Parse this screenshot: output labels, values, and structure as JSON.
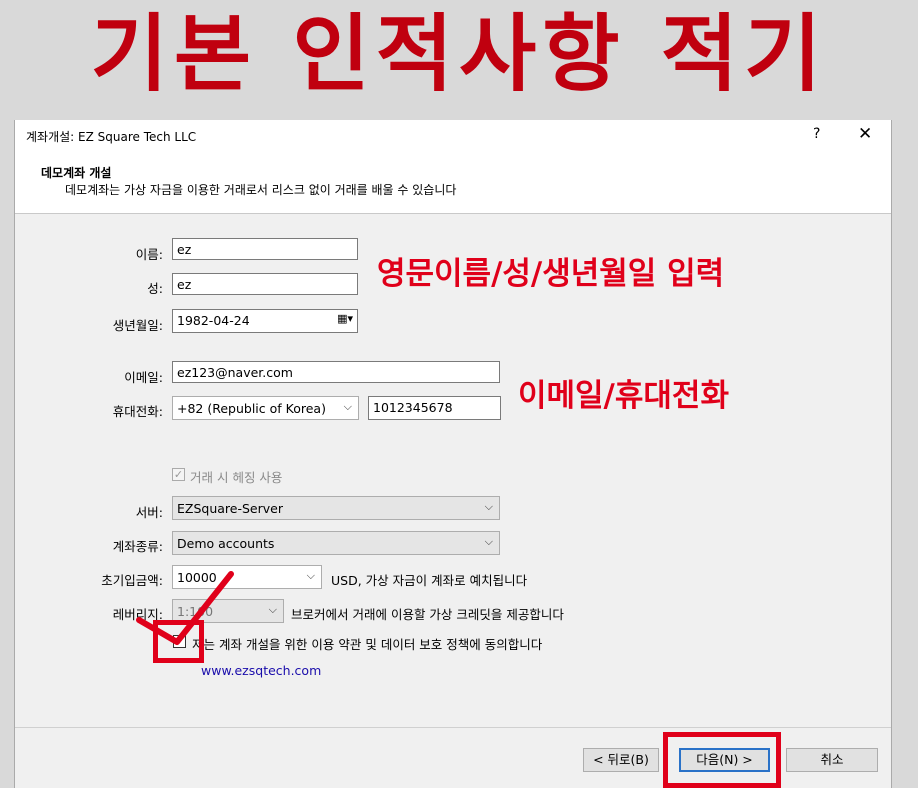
{
  "banner": {
    "title": "기본 인적사항 적기"
  },
  "window": {
    "title": "계좌개설: EZ Square Tech LLC",
    "help": "?",
    "close": "✕"
  },
  "header": {
    "heading": "데모계좌 개설",
    "description": "데모계좌는 가상 자금을 이용한 거래로서 리스크 없이 거래를 배울 수 있습니다"
  },
  "form": {
    "first_name": {
      "label": "이름:",
      "value": "ez"
    },
    "last_name": {
      "label": "성:",
      "value": "ez"
    },
    "birthdate": {
      "label": "생년월일:",
      "value": "1982-04-24"
    },
    "email": {
      "label": "이메일:",
      "value": "ez123@naver.com"
    },
    "phone": {
      "label": "휴대전화:",
      "country": "+82 (Republic of Korea)",
      "number": "1012345678"
    },
    "hedging": {
      "label": "거래 시 헤징 사용",
      "checked": true,
      "disabled": true
    },
    "server": {
      "label": "서버:",
      "value": "EZSquare-Server"
    },
    "account_type": {
      "label": "계좌종류:",
      "value": "Demo accounts"
    },
    "deposit": {
      "label": "초기입금액:",
      "value": "10000",
      "note": "USD, 가상 자금이 계좌로 예치됩니다"
    },
    "leverage": {
      "label": "레버리지:",
      "value": "1:100",
      "note": "브로커에서 거래에 이용할 가상 크레딧을 제공합니다"
    },
    "agreement": {
      "label": "저는 계좌 개설을 위한 이용 약관 및 데이터 보호 정책에 동의합니다",
      "checked": false
    },
    "link": "www.ezsqtech.com"
  },
  "annotations": {
    "names": "영문이름/성/생년월일 입력",
    "contact": "이메일/휴대전화"
  },
  "buttons": {
    "back": "< 뒤로(B)",
    "next": "다음(N) >",
    "cancel": "취소"
  },
  "colors": {
    "annotation_red": "#e0001a",
    "banner_red": "#c0000f",
    "link_blue": "#1a0dab"
  }
}
